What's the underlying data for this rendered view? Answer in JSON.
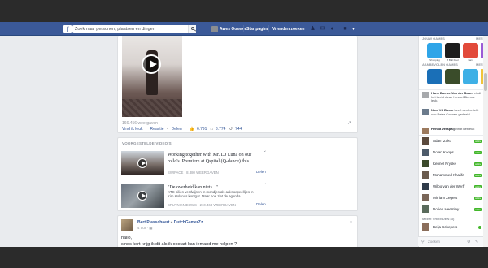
{
  "topbar": {
    "logo": "f",
    "search_placeholder": "Zoek naar personen, plaatsen en dingen",
    "user_name": "Awes Ooswer",
    "startpage": "Startpagina",
    "find_friends": "Vrienden zoeken"
  },
  "video_post": {
    "views": "166.456 weergaven",
    "like": "Vind ik leuk",
    "comment": "Reactie",
    "share": "Delen",
    "likes_count": "6.791",
    "comments_count": "3.774",
    "shares_count": "744"
  },
  "suggested": {
    "title": "VOORGESTELDE VIDEO'S",
    "items": [
      {
        "title": "Working together with Mr. DJ Luna on our rollo's. Premiere at Qspital (Q-dance) this...",
        "desc": "",
        "meta": "SWIFACE · 8.380 WEERGAVEN",
        "button": "Delen"
      },
      {
        "title": "\"De overheid kan niets...\"",
        "desc": "KTC-pilien verdwijnen in mondjes als aaksoepeellijes in Kim Holands kontgat. Maar hoe ziet de agenda...",
        "meta": "SPUTNIKNIEUWS · 210.463 WEERGAVEN",
        "button": "Delen"
      }
    ]
  },
  "user_post": {
    "author": "Bert Plasschaert",
    "target": "DutchGamerZz",
    "time": "4 uur",
    "text1": "hallo,",
    "text2": "sinds kort krijg ik dit als ik opstart kan iemand me helpen ?"
  },
  "sidebar": {
    "games_title": "JOUW GAMES",
    "games_more": "MEER",
    "games": [
      "Shopping",
      "8 Ball Pool",
      "Farm",
      "Candy"
    ],
    "recommended_title": "AANBEVOLEN GAMES",
    "recommended_more": "MEER",
    "recommended": [
      "Pool Live",
      "Tank",
      "Pet Rescue",
      "Candy Soda"
    ],
    "ticker": [
      {
        "name": "Hans Doewe Van der Boom",
        "text": "vindt het bericht van Hessel Bierma leuk."
      },
      {
        "name": "Nico Vd Boom",
        "text": "heeft een bericht van Peter Coenen gedeeld."
      },
      {
        "name": "Henna Verspaij",
        "text": "vindt het leuk"
      }
    ],
    "contacts": [
      {
        "name": "Adam Zoko",
        "status": "online"
      },
      {
        "name": "Nolan Koops",
        "status": "online"
      },
      {
        "name": "Kennel Pryske",
        "status": "online"
      },
      {
        "name": "Mohammed Khalifa",
        "status": "online"
      },
      {
        "name": "Wilbo van der Werff",
        "status": "online"
      },
      {
        "name": "Mirriam Zegers",
        "status": "online"
      },
      {
        "name": "Dorien Heemley",
        "status": "online"
      }
    ],
    "more_friends_title": "MEER VRIENDEN (3)",
    "more_friends": [
      {
        "name": "Beija Schepers"
      }
    ],
    "chat_search": "Zoeken"
  }
}
